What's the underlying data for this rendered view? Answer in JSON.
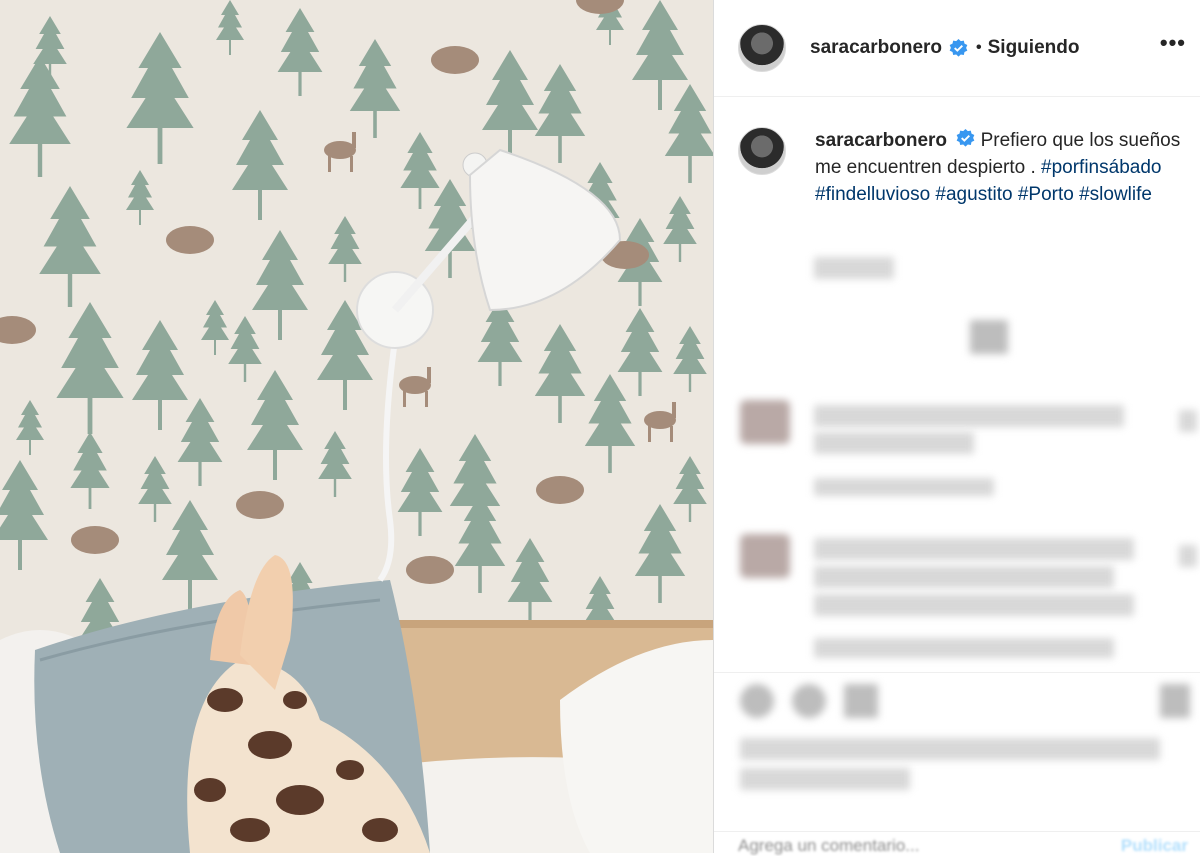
{
  "post": {
    "header": {
      "username": "saracarbonero",
      "separator": "•",
      "follow_status": "Siguiendo",
      "more_glyph": "•••"
    },
    "caption": {
      "username": "saracarbonero",
      "text": "Prefiero que los sueños me encuentren despierto .",
      "hashtags": [
        "#porfinsábado",
        "#findelluvioso",
        "#agustito",
        "#Porto",
        "#slowlife"
      ]
    },
    "comment_box": {
      "placeholder": "Agrega un comentario...",
      "publish_label": "Publicar"
    },
    "colors": {
      "verified_blue": "#3897f0",
      "hashtag_link": "#00376b",
      "tree_green": "#8fa89a",
      "wallpaper": "#ece7df"
    },
    "icons": {
      "verified": "verified-badge-icon",
      "more": "more-options-icon",
      "like": "heart-icon",
      "comment": "comment-icon",
      "share": "share-icon",
      "save": "bookmark-icon"
    }
  }
}
